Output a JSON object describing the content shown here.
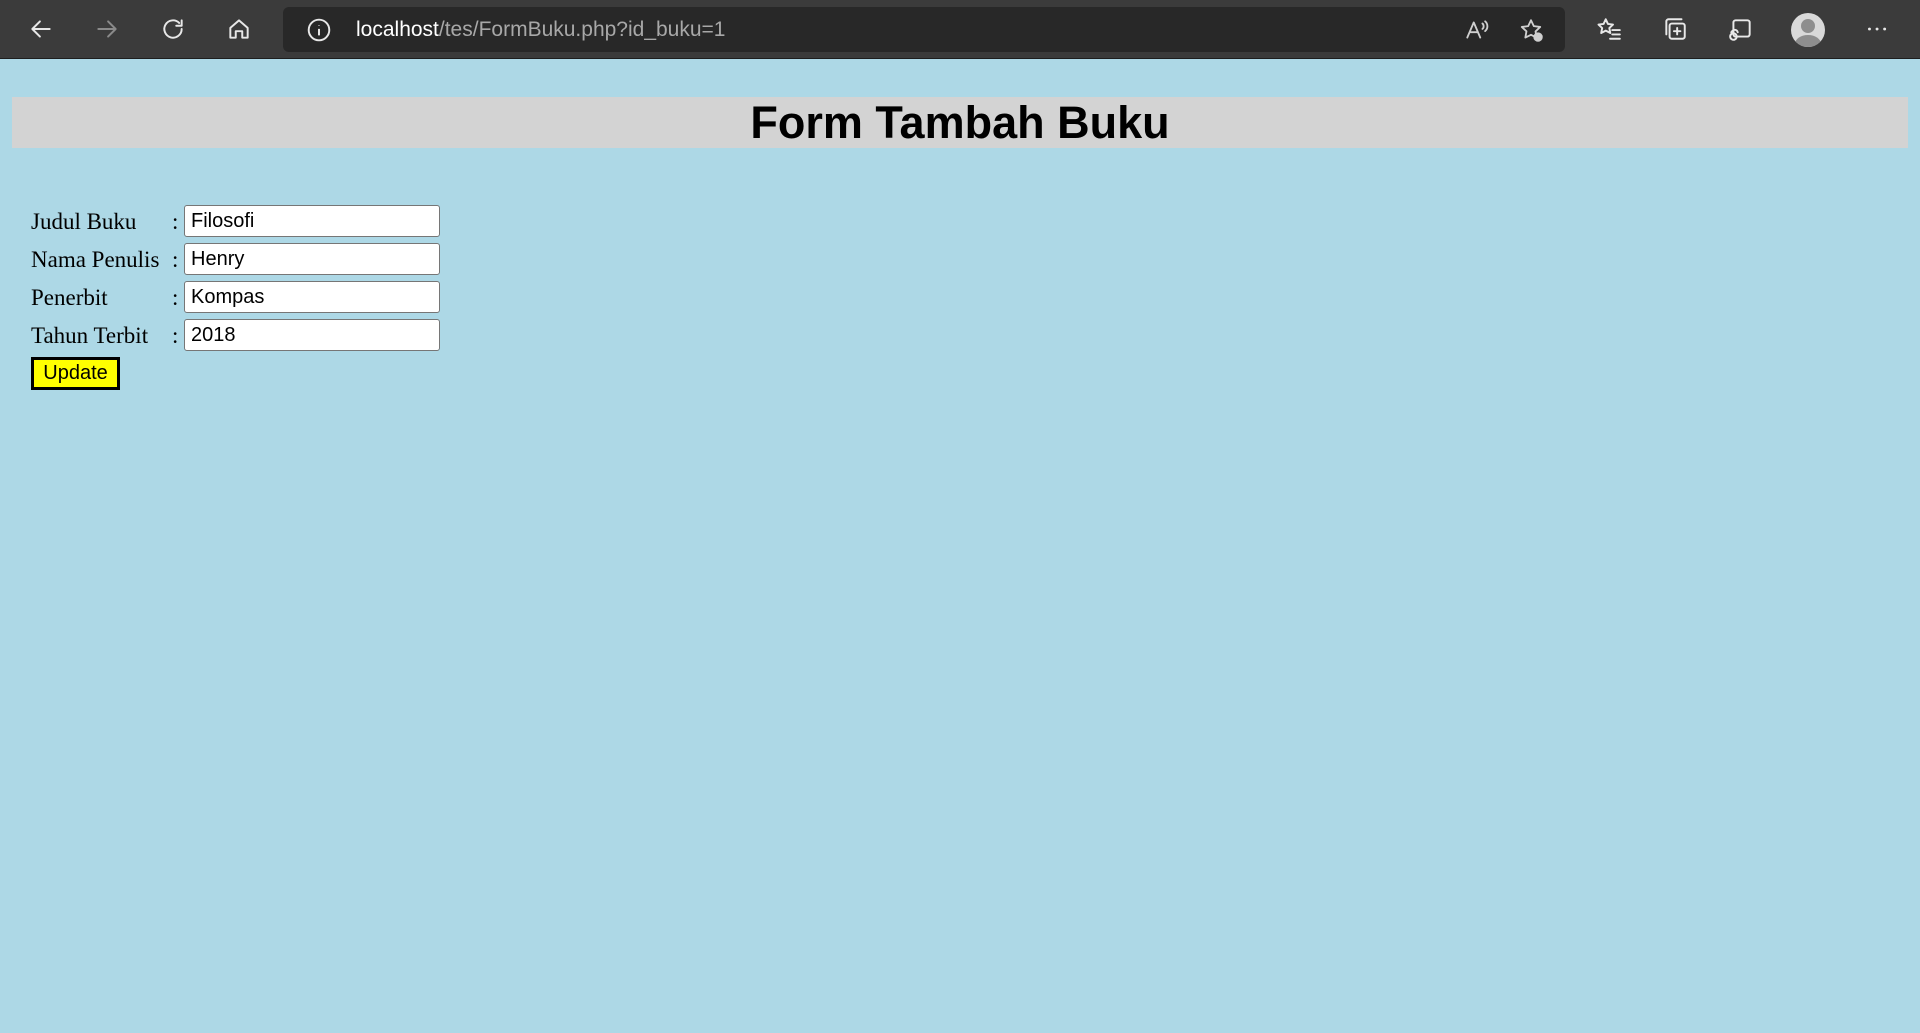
{
  "browser": {
    "url_host": "localhost",
    "url_path": "/tes/FormBuku.php?id_buku=1",
    "icons": [
      "back-arrow-icon",
      "forward-arrow-icon",
      "refresh-icon",
      "home-icon",
      "info-icon",
      "read-aloud-icon",
      "add-favorite-icon",
      "favorites-icon",
      "collections-icon",
      "browser-essentials-icon",
      "profile-avatar-icon",
      "more-icon"
    ]
  },
  "page": {
    "title": "Form Tambah Buku",
    "colors": {
      "background": "#add8e6",
      "title_bar": "#d3d3d3",
      "button": "#ffff00"
    },
    "form": {
      "fields": [
        {
          "label": "Judul Buku",
          "value": "Filosofi"
        },
        {
          "label": "Nama Penulis",
          "value": "Henry"
        },
        {
          "label": "Penerbit",
          "value": "Kompas"
        },
        {
          "label": "Tahun Terbit",
          "value": "2018"
        }
      ],
      "colon": ":",
      "submit_label": "Update"
    }
  }
}
